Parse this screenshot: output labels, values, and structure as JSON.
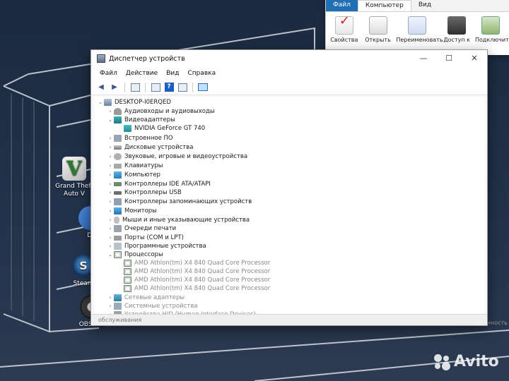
{
  "desktop": {
    "icons": [
      {
        "label": "Grand Theft\nAuto V",
        "glyph": "V"
      },
      {
        "label": "Di",
        "glyph": ""
      },
      {
        "label": "Steam",
        "glyph": "S"
      },
      {
        "label": "OBS Stu",
        "glyph": ""
      }
    ]
  },
  "explorer": {
    "tabs": [
      "Файл",
      "Компьютер",
      "Вид"
    ],
    "ribbon": [
      "Свойства",
      "Открыть",
      "Переименовать",
      "Доступ к",
      "Подключить"
    ]
  },
  "device_manager": {
    "title": "Диспетчер устройств",
    "window_controls": {
      "minimize": "—",
      "maximize": "☐",
      "close": "✕"
    },
    "menu": [
      "Файл",
      "Действие",
      "Вид",
      "Справка"
    ],
    "tree": {
      "root": "DESKTOP-I0ERQED",
      "categories": [
        {
          "label": "Аудиовходы и аудиовыходы",
          "expanded": false,
          "icon": "audio-icon"
        },
        {
          "label": "Видеоадаптеры",
          "expanded": true,
          "icon": "display-adapter-icon",
          "children": [
            "NVIDIA GeForce GT 740"
          ]
        },
        {
          "label": "Встроенное ПО",
          "expanded": false,
          "icon": "firmware-icon"
        },
        {
          "label": "Дисковые устройства",
          "expanded": false,
          "icon": "disk-icon"
        },
        {
          "label": "Звуковые, игровые и видеоустройства",
          "expanded": false,
          "icon": "sound-icon"
        },
        {
          "label": "Клавиатуры",
          "expanded": false,
          "icon": "keyboard-icon"
        },
        {
          "label": "Компьютер",
          "expanded": false,
          "icon": "computer-icon"
        },
        {
          "label": "Контроллеры IDE ATA/ATAPI",
          "expanded": false,
          "icon": "ide-icon"
        },
        {
          "label": "Контроллеры USB",
          "expanded": false,
          "icon": "usb-icon"
        },
        {
          "label": "Контроллеры запоминающих устройств",
          "expanded": false,
          "icon": "storage-icon"
        },
        {
          "label": "Мониторы",
          "expanded": false,
          "icon": "monitor-icon"
        },
        {
          "label": "Мыши и иные указывающие устройства",
          "expanded": false,
          "icon": "mouse-icon"
        },
        {
          "label": "Очереди печати",
          "expanded": false,
          "icon": "print-queue-icon"
        },
        {
          "label": "Порты (COM и LPT)",
          "expanded": false,
          "icon": "port-icon"
        },
        {
          "label": "Программные устройства",
          "expanded": false,
          "icon": "software-device-icon"
        },
        {
          "label": "Процессоры",
          "expanded": true,
          "icon": "processor-icon",
          "children": [
            "AMD Athlon(tm) X4 840 Quad Core Processor",
            "AMD Athlon(tm) X4 840 Quad Core Processor",
            "AMD Athlon(tm) X4 840 Quad Core Processor",
            "AMD Athlon(tm) X4 840 Quad Core Processor"
          ]
        },
        {
          "label": "Сетевые адаптеры",
          "expanded": false,
          "icon": "network-adapter-icon"
        },
        {
          "label": "Системные устройства",
          "expanded": false,
          "icon": "system-device-icon"
        },
        {
          "label": "Устройства HID (Human Interface Devices)",
          "expanded": false,
          "icon": "hid-icon"
        }
      ]
    },
    "status": "обслуживания"
  },
  "behind_text": "мность",
  "watermark": "Avito"
}
